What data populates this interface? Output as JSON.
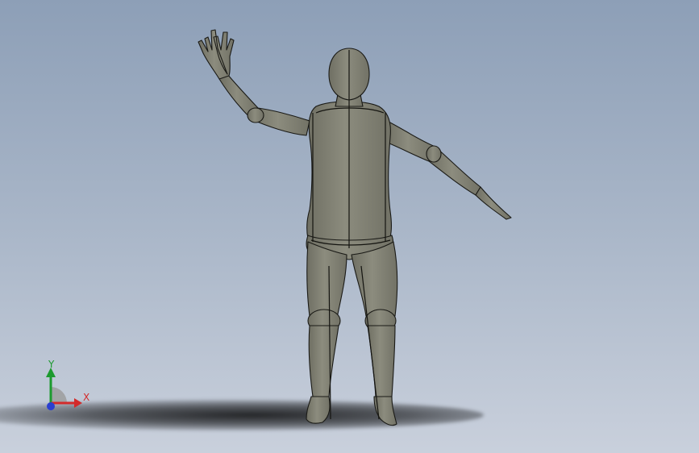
{
  "viewport": {
    "background_top": "#8d9fb7",
    "background_bottom": "#c9d0dc",
    "model_color": "#858578",
    "outline_color": "#1a1a16"
  },
  "triad": {
    "x_label": "X",
    "y_label": "Y",
    "x_color": "#d32a2a",
    "y_color": "#1c9a2e",
    "z_color": "#2a3fd0"
  }
}
